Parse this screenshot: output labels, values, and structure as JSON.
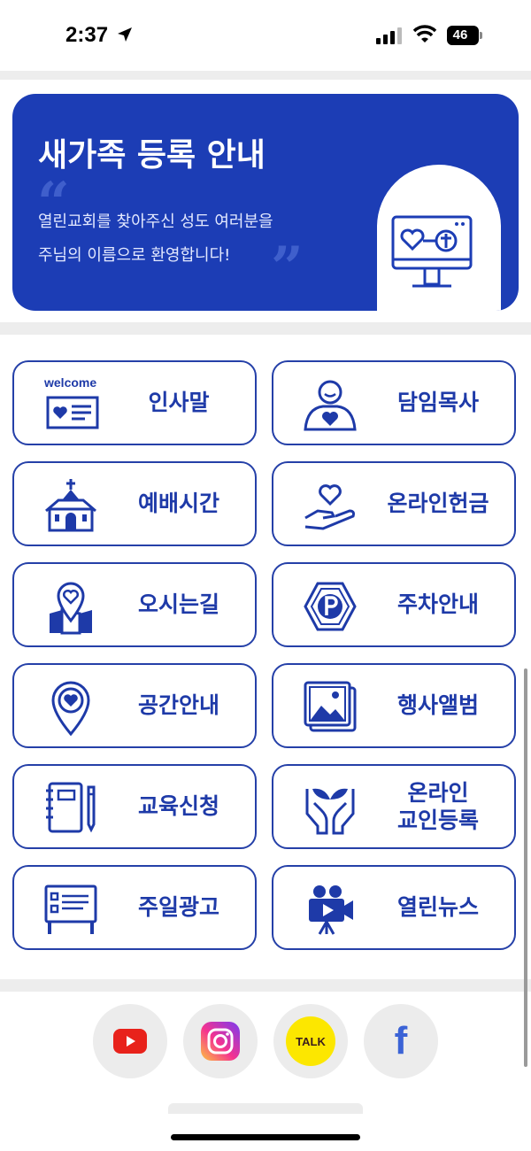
{
  "status_bar": {
    "time": "2:37",
    "battery": "46"
  },
  "banner": {
    "title": "새가족 등록 안내",
    "line1": "열린교회를 찾아주신 성도 여러분을",
    "line2": "주님의 이름으로 환영합니다!",
    "open_quote": "“",
    "close_quote": "”"
  },
  "menu": [
    {
      "label": "인사말",
      "icon": "welcome-card-icon",
      "icon_text": "welcome"
    },
    {
      "label": "담임목사",
      "icon": "pastor-icon"
    },
    {
      "label": "예배시간",
      "icon": "church-icon"
    },
    {
      "label": "온라인헌금",
      "icon": "offering-hand-icon"
    },
    {
      "label": "오시는길",
      "icon": "map-pin-icon"
    },
    {
      "label": "주차안내",
      "icon": "parking-icon"
    },
    {
      "label": "공간안내",
      "icon": "location-heart-icon"
    },
    {
      "label": "행사앨범",
      "icon": "photo-album-icon"
    },
    {
      "label": "교육신청",
      "icon": "notebook-pencil-icon"
    },
    {
      "label": "온라인\n교인등록",
      "icon": "hands-plant-icon"
    },
    {
      "label": "주일광고",
      "icon": "notice-board-icon"
    },
    {
      "label": "열린뉴스",
      "icon": "video-camera-icon"
    }
  ],
  "social": [
    {
      "name": "YouTube",
      "icon": "youtube-icon"
    },
    {
      "name": "Instagram",
      "icon": "instagram-icon"
    },
    {
      "name": "KakaoTalk",
      "icon": "kakaotalk-icon",
      "text": "TALK"
    },
    {
      "name": "Facebook",
      "icon": "facebook-icon",
      "text": "f"
    }
  ],
  "colors": {
    "primary": "#1c3db5",
    "border": "#2540a8",
    "band": "#ededed"
  }
}
